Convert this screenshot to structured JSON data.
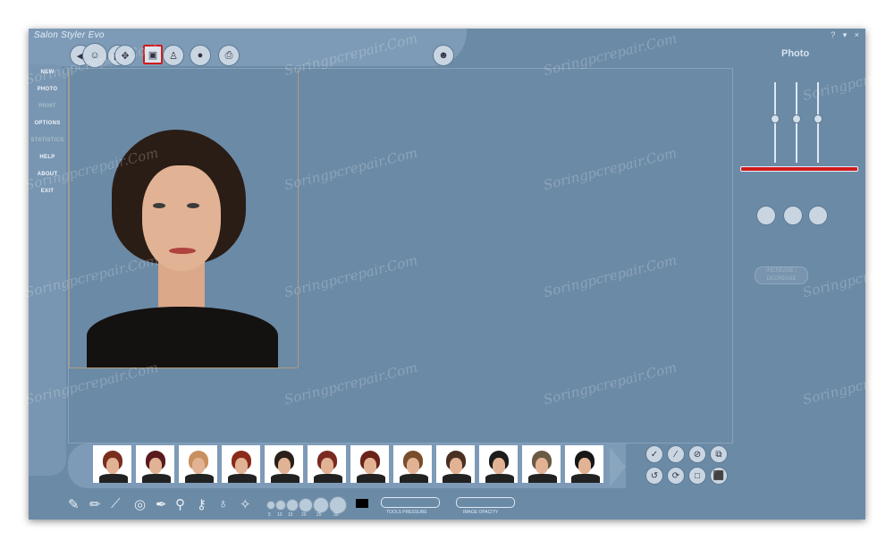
{
  "app": {
    "title": "Salon Styler Evo",
    "window_controls": "? ▾ ×"
  },
  "right_panel": {
    "title": "Photo",
    "button_label": "INCREASE / DECREASE"
  },
  "menu": [
    {
      "label": "NEW",
      "enabled": true
    },
    {
      "label": "PHOTO",
      "enabled": true
    },
    {
      "label": "PRINT",
      "enabled": false
    },
    {
      "label": "OPTIONS",
      "enabled": true
    },
    {
      "label": "STATISTICS",
      "enabled": false
    },
    {
      "label": "HELP",
      "enabled": true
    },
    {
      "label": "ABOUT",
      "enabled": true
    },
    {
      "label": "EXIT",
      "enabled": true
    }
  ],
  "brush_sizes": [
    "5",
    "10",
    "15",
    "20",
    "25",
    "30"
  ],
  "labels": {
    "tools_pressure": "TOOLS PRESSURE",
    "image_opacity": "IMAGE OPACITY"
  },
  "watermark": "Soringpcrepair.Com",
  "colors": {
    "window": "#6b8aa6",
    "accent": "#d01b1b"
  },
  "thumb_hair_colors": [
    "#7a2e1e",
    "#5a1a1e",
    "#c8905e",
    "#8b2a18",
    "#2b1f19",
    "#7b2a22",
    "#6a2417",
    "#7a4e2c",
    "#4a3022",
    "#1c1c1c",
    "#6b5a44",
    "#161616"
  ],
  "icons": {
    "toolbar": [
      "left-arrow-icon",
      "hair-preview-icon",
      "right-arrow-icon",
      "move-icon",
      "photo-frame-icon",
      "mirror-figure-icon",
      "hair-model-icon",
      "print-icon",
      "avatar-icon"
    ],
    "bottom": [
      "brush-icon",
      "pencil-icon",
      "comb-icon",
      "ring-icon",
      "pen-icon",
      "spray-icon",
      "dropper-icon",
      "lasso-icon",
      "wand-icon"
    ],
    "right": [
      "check-icon",
      "slash-icon",
      "no-hair-icon",
      "copy-icon",
      "undo-icon",
      "rotate-icon",
      "square-icon",
      "save-icon"
    ]
  }
}
